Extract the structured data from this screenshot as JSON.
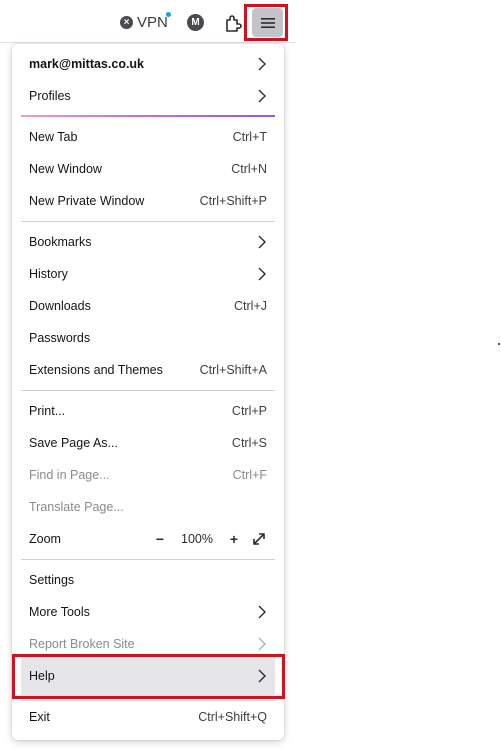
{
  "toolbar": {
    "vpn_label": "VPN",
    "avatar_initial": "M"
  },
  "menu": {
    "account": {
      "label": "mark@mittas.co.uk"
    },
    "profiles": {
      "label": "Profiles"
    },
    "new_tab": {
      "label": "New Tab",
      "shortcut": "Ctrl+T"
    },
    "new_window": {
      "label": "New Window",
      "shortcut": "Ctrl+N"
    },
    "new_private_window": {
      "label": "New Private Window",
      "shortcut": "Ctrl+Shift+P"
    },
    "bookmarks": {
      "label": "Bookmarks"
    },
    "history": {
      "label": "History"
    },
    "downloads": {
      "label": "Downloads",
      "shortcut": "Ctrl+J"
    },
    "passwords": {
      "label": "Passwords"
    },
    "extensions": {
      "label": "Extensions and Themes",
      "shortcut": "Ctrl+Shift+A"
    },
    "print": {
      "label": "Print...",
      "shortcut": "Ctrl+P"
    },
    "save_page": {
      "label": "Save Page As...",
      "shortcut": "Ctrl+S"
    },
    "find": {
      "label": "Find in Page...",
      "shortcut": "Ctrl+F"
    },
    "translate": {
      "label": "Translate Page..."
    },
    "zoom": {
      "label": "Zoom",
      "minus": "−",
      "value": "100%",
      "plus": "+"
    },
    "settings": {
      "label": "Settings"
    },
    "more_tools": {
      "label": "More Tools"
    },
    "report": {
      "label": "Report Broken Site"
    },
    "help": {
      "label": "Help"
    },
    "exit": {
      "label": "Exit",
      "shortcut": "Ctrl+Shift+Q"
    }
  },
  "colors": {
    "highlight_outline": "#d3111e",
    "accent_gradient": [
      "#f59bb5",
      "#c86ad8",
      "#8a5cf0"
    ]
  }
}
